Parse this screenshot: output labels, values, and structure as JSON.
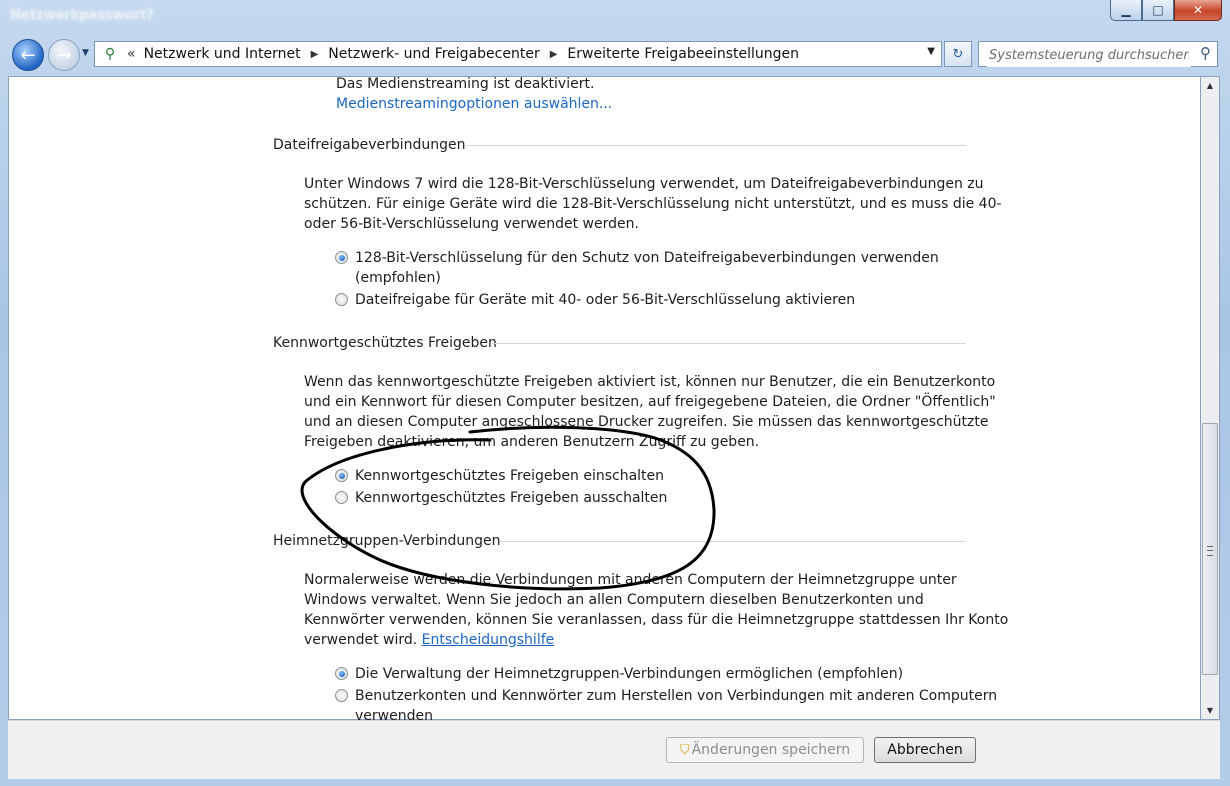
{
  "window": {
    "title": "Netzwerkpasswort?"
  },
  "nav": {
    "back_label": "←",
    "forward_label": "→",
    "breadcrumbs": [
      "Netzwerk und Internet",
      "Netzwerk- und Freigabecenter",
      "Erweiterte Freigabeeinstellungen"
    ],
    "search_placeholder": "Systemsteuerung durchsuchen"
  },
  "media": {
    "status": "Das Medienstreaming ist deaktiviert.",
    "link": "Medienstreamingoptionen auswählen..."
  },
  "file_sharing": {
    "title": "Dateifreigabeverbindungen",
    "description": [
      "Unter Windows 7 wird die 128-Bit-Verschlüsselung verwendet, um Dateifreigabeverbindungen zu",
      "schützen. Für einige Geräte wird die 128-Bit-Verschlüsselung nicht unterstützt, und es muss die 40-",
      "oder 56-Bit-Verschlüsselung verwendet werden."
    ],
    "options": [
      {
        "label": [
          "128-Bit-Verschlüsselung für den Schutz von Dateifreigabeverbindungen verwenden",
          "(empfohlen)"
        ],
        "selected": true
      },
      {
        "label": [
          "Dateifreigabe für Geräte mit 40- oder 56-Bit-Verschlüsselung aktivieren"
        ],
        "selected": false
      }
    ]
  },
  "password_sharing": {
    "title": "Kennwortgeschütztes Freigeben",
    "description": [
      "Wenn das kennwortgeschützte Freigeben aktiviert ist, können nur Benutzer, die ein Benutzerkonto",
      "und ein Kennwort für diesen Computer besitzen, auf freigegebene Dateien, die Ordner \"Öffentlich\"",
      "und an diesen Computer angeschlossene Drucker zugreifen. Sie müssen das kennwortgeschützte",
      "Freigeben deaktivieren, um anderen Benutzern Zugriff zu geben."
    ],
    "options": [
      {
        "label": [
          "Kennwortgeschütztes Freigeben einschalten"
        ],
        "selected": true
      },
      {
        "label": [
          "Kennwortgeschütztes Freigeben ausschalten"
        ],
        "selected": false
      }
    ]
  },
  "homegroup": {
    "title": "Heimnetzgruppen-Verbindungen",
    "description": [
      "Normalerweise werden die Verbindungen mit anderen Computern der Heimnetzgruppe unter",
      "Windows verwaltet. Wenn Sie jedoch an allen Computern dieselben Benutzerkonten und",
      "Kennwörter verwenden, können Sie veranlassen, dass für die Heimnetzgruppe stattdessen Ihr Konto",
      "verwendet wird."
    ],
    "help_link": "Entscheidungshilfe",
    "options": [
      {
        "label": [
          "Die Verwaltung der Heimnetzgruppen-Verbindungen ermöglichen (empfohlen)"
        ],
        "selected": true
      },
      {
        "label": [
          "Benutzerkonten und Kennwörter zum Herstellen von Verbindungen mit anderen Computern",
          "verwenden"
        ],
        "selected": false
      }
    ]
  },
  "footer": {
    "save_label": "Änderungen speichern",
    "cancel_label": "Abbrechen"
  },
  "annotation": {
    "stroke_color": "#000000",
    "shape": "hand-drawn-circle"
  }
}
